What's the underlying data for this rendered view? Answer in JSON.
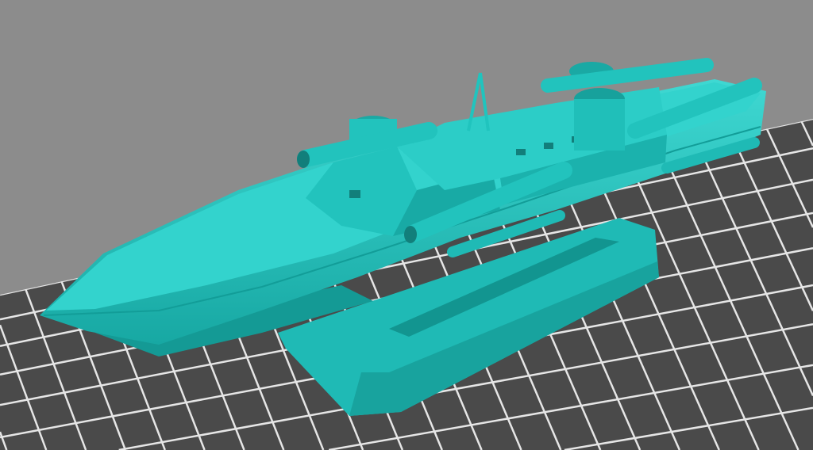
{
  "scene": {
    "background_color": "#8c8c8c",
    "floor_color": "#4a4a4a",
    "grid_line_color": "#e6e6e6",
    "model_color": "#20c4be",
    "model_shadow_color": "#15948f",
    "model_highlight_color": "#4fe0da"
  }
}
